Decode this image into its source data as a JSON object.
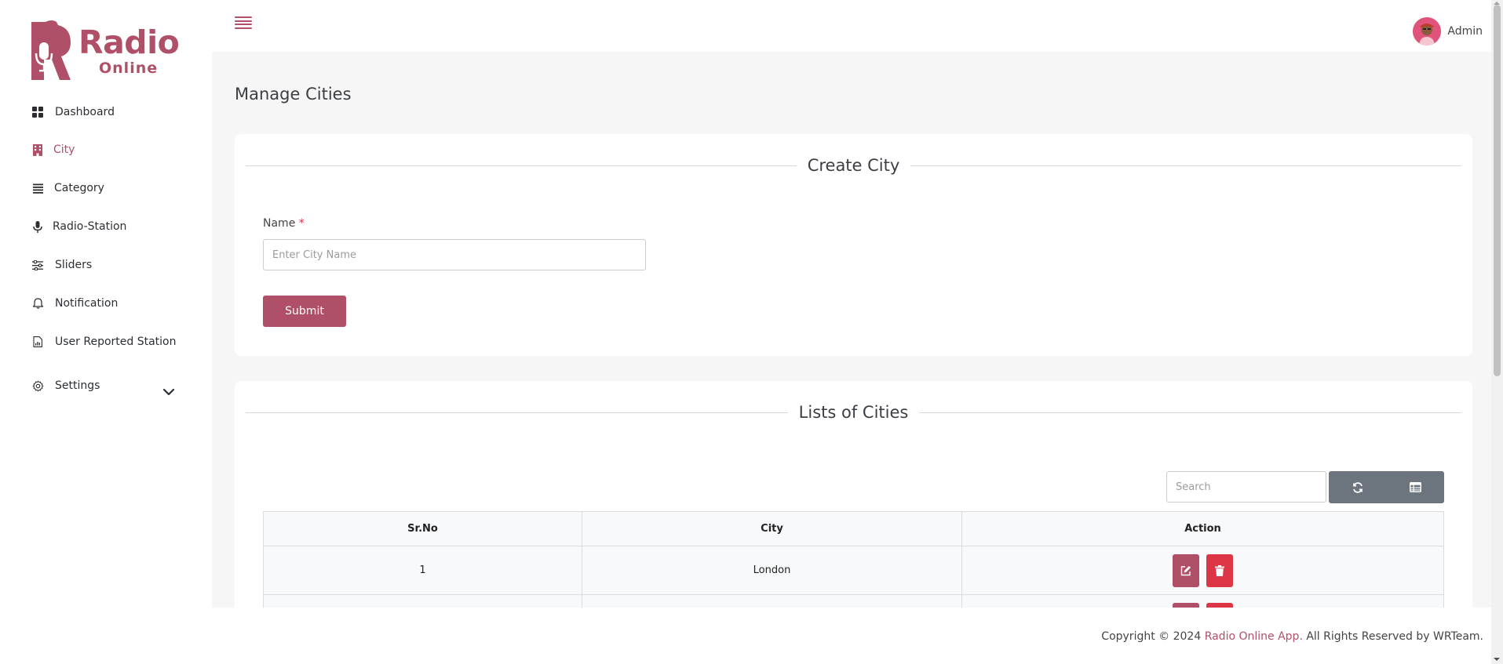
{
  "app": {
    "logo_line1": "Radio",
    "logo_line2": "Online",
    "brand_color": "#b05068"
  },
  "sidebar": {
    "items": [
      {
        "label": "Dashboard",
        "icon": "grid-icon"
      },
      {
        "label": "City",
        "icon": "building-icon",
        "active": true
      },
      {
        "label": "Category",
        "icon": "list-icon"
      },
      {
        "label": "Radio-Station",
        "icon": "microphone-icon"
      },
      {
        "label": "Sliders",
        "icon": "sliders-icon"
      },
      {
        "label": "Notification",
        "icon": "bell-icon"
      },
      {
        "label": "User Reported Station",
        "icon": "report-file-icon"
      },
      {
        "label": "Settings",
        "icon": "gear-icon",
        "expandable": true
      }
    ]
  },
  "header": {
    "user_name": "Admin"
  },
  "page": {
    "title": "Manage Cities"
  },
  "create_form": {
    "title": "Create City",
    "name_label": "Name",
    "required_mark": "*",
    "name_value": "",
    "name_placeholder": "Enter City Name",
    "submit_label": "Submit"
  },
  "city_list": {
    "title": "Lists of Cities",
    "search_placeholder": "Search",
    "columns": [
      "Sr.No",
      "City",
      "Action"
    ],
    "rows": [
      {
        "sr_no": "1",
        "city": "London"
      }
    ]
  },
  "footer": {
    "prefix": "Copyright © 2024 ",
    "link_text": "Radio Online App.",
    "suffix": " All Rights Reserved by WRTeam."
  }
}
